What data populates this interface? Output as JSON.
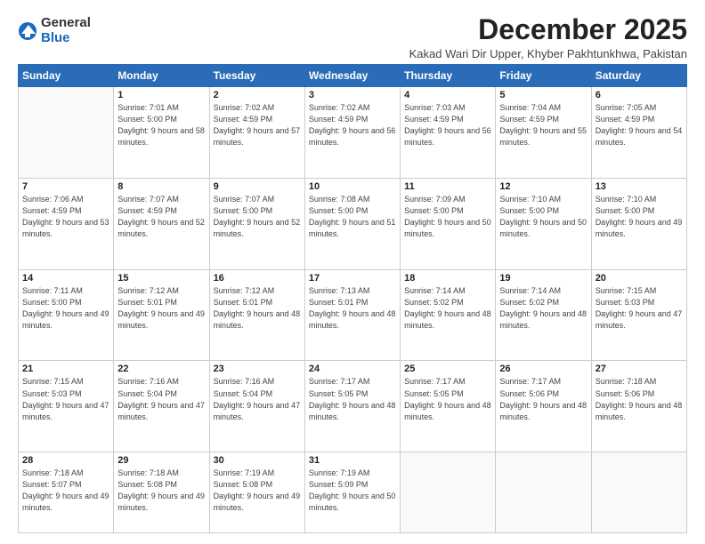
{
  "logo": {
    "general": "General",
    "blue": "Blue"
  },
  "title": "December 2025",
  "subtitle": "Kakad Wari Dir Upper, Khyber Pakhtunkhwa, Pakistan",
  "days_of_week": [
    "Sunday",
    "Monday",
    "Tuesday",
    "Wednesday",
    "Thursday",
    "Friday",
    "Saturday"
  ],
  "weeks": [
    [
      {
        "num": "",
        "empty": true
      },
      {
        "num": "1",
        "sunrise": "7:01 AM",
        "sunset": "5:00 PM",
        "daylight": "9 hours and 58 minutes."
      },
      {
        "num": "2",
        "sunrise": "7:02 AM",
        "sunset": "4:59 PM",
        "daylight": "9 hours and 57 minutes."
      },
      {
        "num": "3",
        "sunrise": "7:02 AM",
        "sunset": "4:59 PM",
        "daylight": "9 hours and 56 minutes."
      },
      {
        "num": "4",
        "sunrise": "7:03 AM",
        "sunset": "4:59 PM",
        "daylight": "9 hours and 56 minutes."
      },
      {
        "num": "5",
        "sunrise": "7:04 AM",
        "sunset": "4:59 PM",
        "daylight": "9 hours and 55 minutes."
      },
      {
        "num": "6",
        "sunrise": "7:05 AM",
        "sunset": "4:59 PM",
        "daylight": "9 hours and 54 minutes."
      }
    ],
    [
      {
        "num": "7",
        "sunrise": "7:06 AM",
        "sunset": "4:59 PM",
        "daylight": "9 hours and 53 minutes."
      },
      {
        "num": "8",
        "sunrise": "7:07 AM",
        "sunset": "4:59 PM",
        "daylight": "9 hours and 52 minutes."
      },
      {
        "num": "9",
        "sunrise": "7:07 AM",
        "sunset": "5:00 PM",
        "daylight": "9 hours and 52 minutes."
      },
      {
        "num": "10",
        "sunrise": "7:08 AM",
        "sunset": "5:00 PM",
        "daylight": "9 hours and 51 minutes."
      },
      {
        "num": "11",
        "sunrise": "7:09 AM",
        "sunset": "5:00 PM",
        "daylight": "9 hours and 50 minutes."
      },
      {
        "num": "12",
        "sunrise": "7:10 AM",
        "sunset": "5:00 PM",
        "daylight": "9 hours and 50 minutes."
      },
      {
        "num": "13",
        "sunrise": "7:10 AM",
        "sunset": "5:00 PM",
        "daylight": "9 hours and 49 minutes."
      }
    ],
    [
      {
        "num": "14",
        "sunrise": "7:11 AM",
        "sunset": "5:00 PM",
        "daylight": "9 hours and 49 minutes."
      },
      {
        "num": "15",
        "sunrise": "7:12 AM",
        "sunset": "5:01 PM",
        "daylight": "9 hours and 49 minutes."
      },
      {
        "num": "16",
        "sunrise": "7:12 AM",
        "sunset": "5:01 PM",
        "daylight": "9 hours and 48 minutes."
      },
      {
        "num": "17",
        "sunrise": "7:13 AM",
        "sunset": "5:01 PM",
        "daylight": "9 hours and 48 minutes."
      },
      {
        "num": "18",
        "sunrise": "7:14 AM",
        "sunset": "5:02 PM",
        "daylight": "9 hours and 48 minutes."
      },
      {
        "num": "19",
        "sunrise": "7:14 AM",
        "sunset": "5:02 PM",
        "daylight": "9 hours and 48 minutes."
      },
      {
        "num": "20",
        "sunrise": "7:15 AM",
        "sunset": "5:03 PM",
        "daylight": "9 hours and 47 minutes."
      }
    ],
    [
      {
        "num": "21",
        "sunrise": "7:15 AM",
        "sunset": "5:03 PM",
        "daylight": "9 hours and 47 minutes."
      },
      {
        "num": "22",
        "sunrise": "7:16 AM",
        "sunset": "5:04 PM",
        "daylight": "9 hours and 47 minutes."
      },
      {
        "num": "23",
        "sunrise": "7:16 AM",
        "sunset": "5:04 PM",
        "daylight": "9 hours and 47 minutes."
      },
      {
        "num": "24",
        "sunrise": "7:17 AM",
        "sunset": "5:05 PM",
        "daylight": "9 hours and 48 minutes."
      },
      {
        "num": "25",
        "sunrise": "7:17 AM",
        "sunset": "5:05 PM",
        "daylight": "9 hours and 48 minutes."
      },
      {
        "num": "26",
        "sunrise": "7:17 AM",
        "sunset": "5:06 PM",
        "daylight": "9 hours and 48 minutes."
      },
      {
        "num": "27",
        "sunrise": "7:18 AM",
        "sunset": "5:06 PM",
        "daylight": "9 hours and 48 minutes."
      }
    ],
    [
      {
        "num": "28",
        "sunrise": "7:18 AM",
        "sunset": "5:07 PM",
        "daylight": "9 hours and 49 minutes."
      },
      {
        "num": "29",
        "sunrise": "7:18 AM",
        "sunset": "5:08 PM",
        "daylight": "9 hours and 49 minutes."
      },
      {
        "num": "30",
        "sunrise": "7:19 AM",
        "sunset": "5:08 PM",
        "daylight": "9 hours and 49 minutes."
      },
      {
        "num": "31",
        "sunrise": "7:19 AM",
        "sunset": "5:09 PM",
        "daylight": "9 hours and 50 minutes."
      },
      {
        "num": "",
        "empty": true
      },
      {
        "num": "",
        "empty": true
      },
      {
        "num": "",
        "empty": true
      }
    ]
  ]
}
